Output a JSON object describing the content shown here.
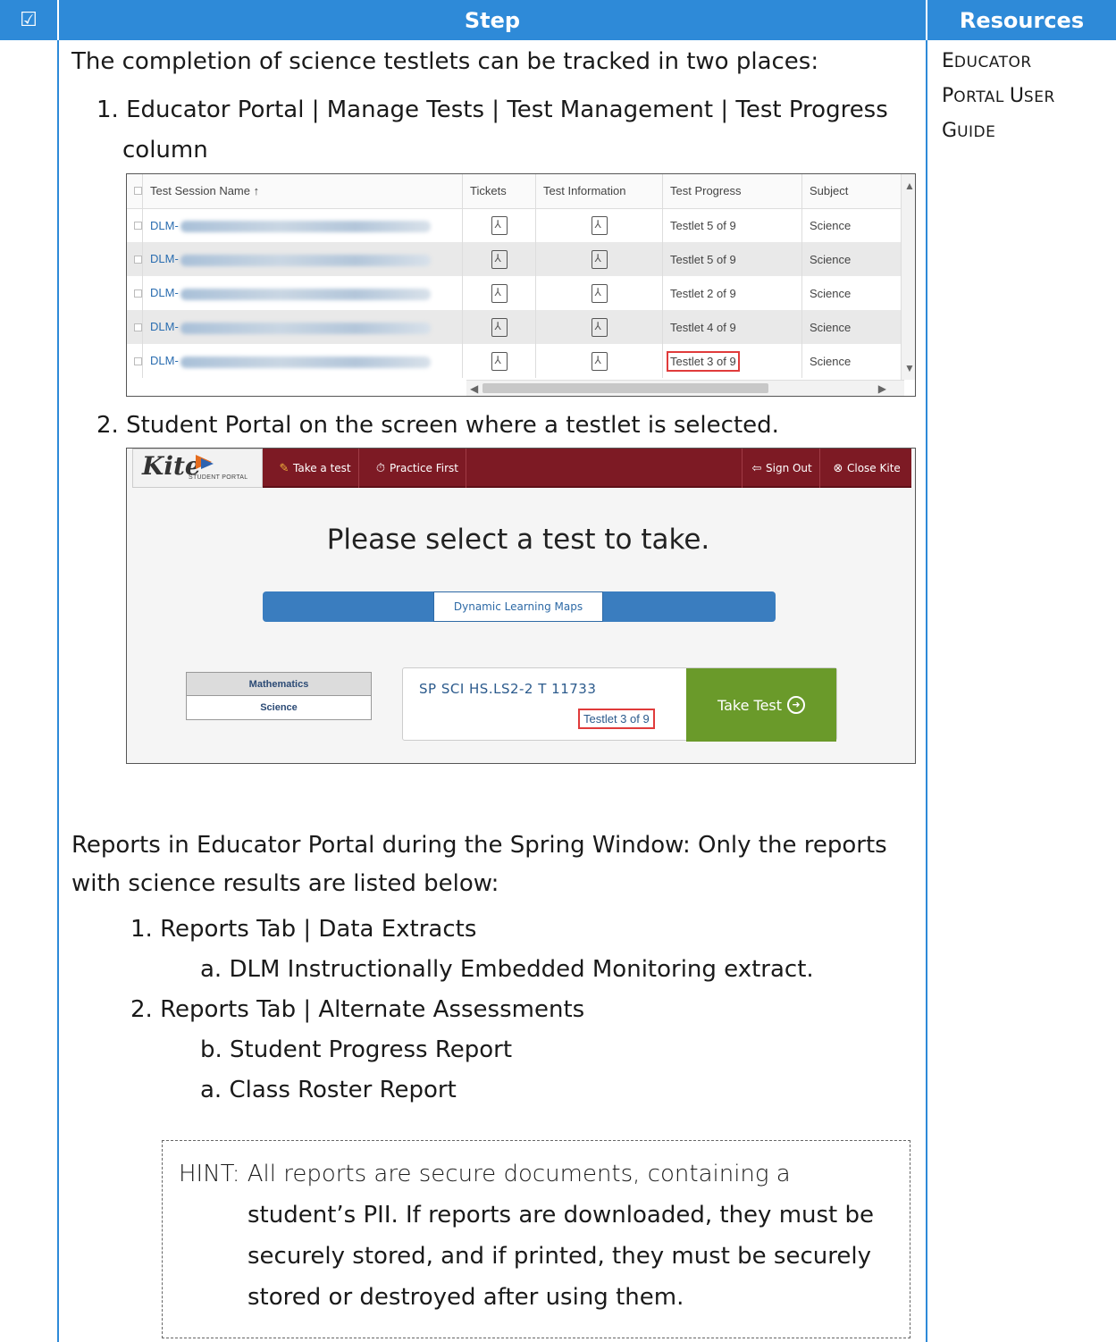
{
  "header": {
    "check_symbol": "☑",
    "step": "Step",
    "resources": "Resources"
  },
  "intro": "The completion of science testlets can be tracked in two places:",
  "track_item1_line1": "1.  Educator Portal | Manage Tests | Test Management | Test Progress",
  "track_item1_line2": "column",
  "table": {
    "columns": [
      "Test Session Name ↑",
      "Tickets",
      "Test Information",
      "Test Progress",
      "Subject"
    ],
    "rows": [
      {
        "name": "DLM-",
        "progress": "Testlet 5 of 9",
        "subject": "Science"
      },
      {
        "name": "DLM-",
        "progress": "Testlet 5 of 9",
        "subject": "Science"
      },
      {
        "name": "DLM-",
        "progress": "Testlet 2 of 9",
        "subject": "Science"
      },
      {
        "name": "DLM-",
        "progress": "Testlet 4 of 9",
        "subject": "Science"
      },
      {
        "name": "DLM-",
        "progress": "Testlet 3 of 9",
        "subject": "Science"
      }
    ]
  },
  "track_item2": "2.  Student Portal on the screen where a testlet is selected.",
  "kite": {
    "logo": "Kite",
    "logo_sub": "STUDENT PORTAL",
    "nav_take": "Take a test",
    "nav_practice": "Practice First",
    "nav_signout": "Sign Out",
    "nav_close": "Close Kite",
    "title": "Please select a test to take.",
    "tab_active": "Dynamic Learning Maps",
    "subjects": [
      "Mathematics",
      "Science"
    ],
    "test_name": "SP SCI HS.LS2-2 T 11733",
    "testlet": "Testlet 3 of 9",
    "take_btn": "Take Test"
  },
  "reports_line1": "Reports in Educator Portal during the Spring Window: Only the reports",
  "reports_line2": "with science results are listed below:",
  "report_items": [
    "1.  Reports Tab | Data Extracts",
    "a.   DLM Instructionally Embedded Monitoring extract.",
    "2.  Reports Tab | Alternate Assessments",
    "b.   Student Progress Report",
    "a.   Class Roster Report"
  ],
  "hint_lines": [
    "HINT: All reports are secure documents, containing a",
    "student’s PII. If reports are downloaded, they must be",
    "securely stored, and if printed, they must be securely",
    "stored or destroyed after using them."
  ],
  "resources_text": {
    "l1_cap": "E",
    "l1_rest": "DUCATOR",
    "l2_cap": "P",
    "l2_rest": "ORTAL ",
    "l2_cap2": "U",
    "l2_rest2": "SER",
    "l3_cap": "G",
    "l3_rest": "UIDE"
  },
  "colors": {
    "header_blue": "#2e8ad8",
    "kite_bar": "#7d1a24",
    "take_green": "#6a9a2a",
    "highlight_red": "#e03b3b"
  }
}
